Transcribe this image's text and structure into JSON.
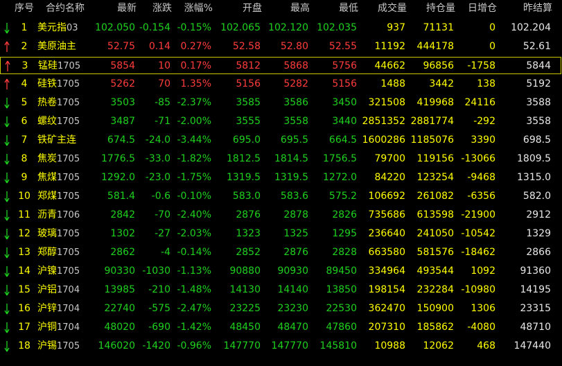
{
  "colors": {
    "up": "#ff3c3c",
    "down": "#1ed21e",
    "flat": "#e8e8e8",
    "accent": "#ffff00",
    "header": "#c8c8c8"
  },
  "header": {
    "idx": "序号",
    "name": "合约名称",
    "last": "最新",
    "chg": "涨跌",
    "pct": "涨幅%",
    "open": "开盘",
    "high": "最高",
    "low": "最低",
    "vol": "成交量",
    "oi": "持仓量",
    "oi_chg": "日增仓",
    "prev": "昨结算"
  },
  "rows": [
    {
      "idx": "1",
      "name": "美元指",
      "code": "03",
      "dir": "down",
      "last": "102.050",
      "chg": "-0.154",
      "pct": "-0.15%",
      "open": "102.065",
      "high": "102.120",
      "low": "102.035",
      "vol": "937",
      "oi": "71131",
      "oi_chg": "0",
      "prev": "102.204"
    },
    {
      "idx": "2",
      "name": "美原油主",
      "code": "",
      "dir": "up",
      "last": "52.75",
      "chg": "0.14",
      "pct": "0.27%",
      "open": "52.58",
      "high": "52.80",
      "low": "52.55",
      "vol": "11192",
      "oi": "444178",
      "oi_chg": "0",
      "prev": "52.61"
    },
    {
      "idx": "3",
      "name": "锰硅",
      "code": "1705",
      "dir": "up",
      "last": "5854",
      "chg": "10",
      "pct": "0.17%",
      "open": "5812",
      "high": "5868",
      "low": "5756",
      "vol": "44662",
      "oi": "96856",
      "oi_chg": "-1758",
      "prev": "5844",
      "selected": true
    },
    {
      "idx": "4",
      "name": "硅铁",
      "code": "1705",
      "dir": "up",
      "last": "5262",
      "chg": "70",
      "pct": "1.35%",
      "open": "5156",
      "high": "5282",
      "low": "5156",
      "vol": "1488",
      "oi": "3442",
      "oi_chg": "138",
      "prev": "5192"
    },
    {
      "idx": "5",
      "name": "热卷",
      "code": "1705",
      "dir": "down",
      "last": "3503",
      "chg": "-85",
      "pct": "-2.37%",
      "open": "3585",
      "high": "3586",
      "low": "3450",
      "vol": "321508",
      "oi": "419968",
      "oi_chg": "24116",
      "prev": "3588"
    },
    {
      "idx": "6",
      "name": "螺纹",
      "code": "1705",
      "dir": "down",
      "last": "3487",
      "chg": "-71",
      "pct": "-2.00%",
      "open": "3555",
      "high": "3558",
      "low": "3440",
      "vol": "2851352",
      "oi": "2881774",
      "oi_chg": "-292",
      "prev": "3558"
    },
    {
      "idx": "7",
      "name": "铁矿主连",
      "code": "",
      "dir": "down",
      "last": "674.5",
      "chg": "-24.0",
      "pct": "-3.44%",
      "open": "695.0",
      "high": "695.5",
      "low": "664.5",
      "vol": "1600286",
      "oi": "1185076",
      "oi_chg": "3390",
      "prev": "698.5"
    },
    {
      "idx": "8",
      "name": "焦炭",
      "code": "1705",
      "dir": "down",
      "last": "1776.5",
      "chg": "-33.0",
      "pct": "-1.82%",
      "open": "1812.5",
      "high": "1814.5",
      "low": "1756.5",
      "vol": "79700",
      "oi": "119156",
      "oi_chg": "-13066",
      "prev": "1809.5"
    },
    {
      "idx": "9",
      "name": "焦煤",
      "code": "1705",
      "dir": "down",
      "last": "1292.0",
      "chg": "-23.0",
      "pct": "-1.75%",
      "open": "1319.5",
      "high": "1319.5",
      "low": "1272.0",
      "vol": "84220",
      "oi": "123254",
      "oi_chg": "-9468",
      "prev": "1315.0"
    },
    {
      "idx": "10",
      "name": "郑煤",
      "code": "1705",
      "dir": "down",
      "last": "581.4",
      "chg": "-0.6",
      "pct": "-0.10%",
      "open": "583.0",
      "high": "583.6",
      "low": "575.2",
      "vol": "106692",
      "oi": "261082",
      "oi_chg": "-6356",
      "prev": "582.0"
    },
    {
      "idx": "11",
      "name": "沥青",
      "code": "1706",
      "dir": "down",
      "last": "2842",
      "chg": "-70",
      "pct": "-2.40%",
      "open": "2876",
      "high": "2878",
      "low": "2826",
      "vol": "735686",
      "oi": "613598",
      "oi_chg": "-21900",
      "prev": "2912"
    },
    {
      "idx": "12",
      "name": "玻璃",
      "code": "1705",
      "dir": "down",
      "last": "1302",
      "chg": "-27",
      "pct": "-2.03%",
      "open": "1323",
      "high": "1325",
      "low": "1295",
      "vol": "236640",
      "oi": "241050",
      "oi_chg": "-10542",
      "prev": "1329"
    },
    {
      "idx": "13",
      "name": "郑醇",
      "code": "1705",
      "dir": "down",
      "last": "2862",
      "chg": "-4",
      "pct": "-0.14%",
      "open": "2852",
      "high": "2876",
      "low": "2828",
      "vol": "663580",
      "oi": "581576",
      "oi_chg": "-18462",
      "prev": "2866"
    },
    {
      "idx": "14",
      "name": "沪镍",
      "code": "1705",
      "dir": "down",
      "last": "90330",
      "chg": "-1030",
      "pct": "-1.13%",
      "open": "90880",
      "high": "90930",
      "low": "89450",
      "vol": "334964",
      "oi": "493544",
      "oi_chg": "1092",
      "prev": "91360"
    },
    {
      "idx": "15",
      "name": "沪铝",
      "code": "1704",
      "dir": "down",
      "last": "13985",
      "chg": "-210",
      "pct": "-1.48%",
      "open": "14130",
      "high": "14140",
      "low": "13850",
      "vol": "198154",
      "oi": "232284",
      "oi_chg": "-10980",
      "prev": "14195"
    },
    {
      "idx": "16",
      "name": "沪锌",
      "code": "1704",
      "dir": "down",
      "last": "22740",
      "chg": "-575",
      "pct": "-2.47%",
      "open": "23225",
      "high": "23230",
      "low": "22530",
      "vol": "362470",
      "oi": "150900",
      "oi_chg": "1306",
      "prev": "23315"
    },
    {
      "idx": "17",
      "name": "沪铜",
      "code": "1704",
      "dir": "down",
      "last": "48020",
      "chg": "-690",
      "pct": "-1.42%",
      "open": "48450",
      "high": "48470",
      "low": "47860",
      "vol": "207310",
      "oi": "185862",
      "oi_chg": "-4080",
      "prev": "48710"
    },
    {
      "idx": "18",
      "name": "沪锡",
      "code": "1705",
      "dir": "down",
      "last": "146020",
      "chg": "-1420",
      "pct": "-0.96%",
      "open": "147770",
      "high": "147770",
      "low": "145810",
      "vol": "10988",
      "oi": "12062",
      "oi_chg": "468",
      "prev": "147440"
    }
  ]
}
